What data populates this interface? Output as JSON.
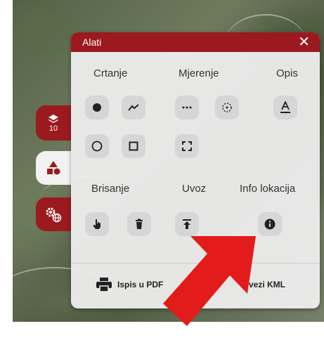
{
  "panel": {
    "title": "Alati",
    "close_icon": "close-icon"
  },
  "sections": {
    "crtanje": "Crtanje",
    "mjerenje": "Mjerenje",
    "opis": "Opis",
    "brisanje": "Brisanje",
    "uvoz": "Uvoz",
    "info": "Info lokacija"
  },
  "tools": {
    "point": "point-icon",
    "line": "polyline-icon",
    "measure_distance": "measure-distance-icon",
    "measure_area": "measure-area-icon",
    "text": "text-label-icon",
    "circle": "circle-icon",
    "rectangle": "rectangle-icon",
    "polygon": "polygon-icon",
    "delete_select": "hand-pointer-icon",
    "delete_all": "trash-icon",
    "import": "upload-icon",
    "info": "info-icon"
  },
  "footer": {
    "print_pdf": "Ispis u PDF",
    "export_kml": "vezi KML"
  },
  "side_tabs": {
    "layers_count": "10"
  },
  "colors": {
    "accent": "#9b1a1f",
    "panel_bg": "#eeeeee",
    "tool_bg": "#d6d6d6",
    "arrow": "#e31b1b"
  }
}
